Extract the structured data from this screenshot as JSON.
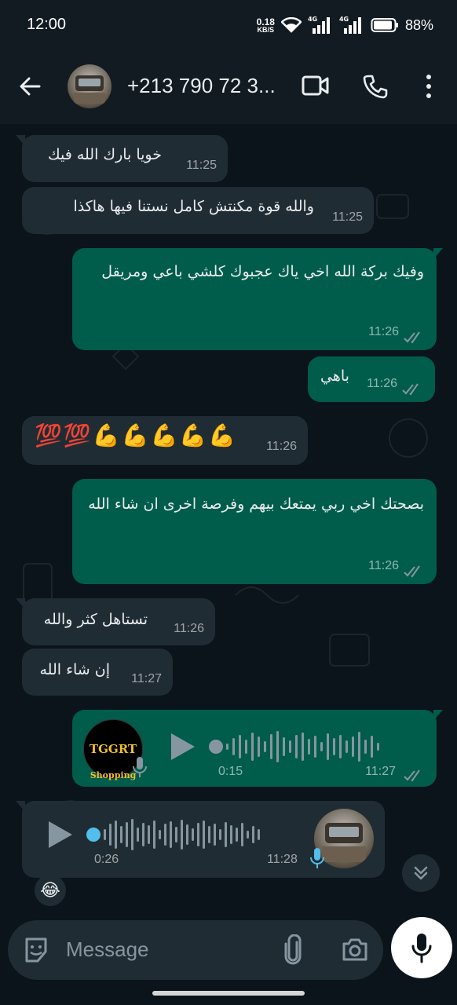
{
  "status_bar": {
    "time": "12:00",
    "net_speed_value": "0.18",
    "net_speed_unit": "KB/S",
    "network_1": "4G",
    "network_2": "4G",
    "battery": "88%"
  },
  "header": {
    "title": "+213 790 72 3...",
    "icons": [
      "back-arrow-icon",
      "video-call-icon",
      "voice-call-icon",
      "more-options-icon"
    ]
  },
  "messages": [
    {
      "direction": "in",
      "text": "خويا بارك الله فيك",
      "time": "11:25"
    },
    {
      "direction": "in",
      "text": "والله قوة مكنتش كامل نستنا فيها هاكذا",
      "time": "11:25"
    },
    {
      "direction": "out",
      "text": "وفيك بركة الله اخي ياك عجبوك كلشي باعي ومريقل",
      "time": "11:26"
    },
    {
      "direction": "out",
      "text": "باهي",
      "time": "11:26"
    },
    {
      "direction": "in",
      "text": "💯💯💪💪💪💪💪",
      "time": "11:26"
    },
    {
      "direction": "out",
      "text": "بصحتك اخي ربي يمتعك بيهم وفرصة اخرى ان شاء الله",
      "time": "11:26"
    },
    {
      "direction": "in",
      "text": "تستاهل كثر والله",
      "time": "11:26"
    },
    {
      "direction": "in",
      "text": "إن شاء الله",
      "time": "11:27"
    }
  ],
  "voice_out": {
    "sender_logo_line1": "TGGRT",
    "sender_logo_line2": "Shopping",
    "duration": "0:15",
    "time": "11:27"
  },
  "voice_in": {
    "duration": "0:26",
    "time": "11:28",
    "reaction": "😂"
  },
  "input": {
    "placeholder": "Message"
  },
  "colors": {
    "incoming": "#202c33",
    "outgoing": "#005c4b",
    "background": "#0b141a",
    "accent_blue": "#53bdeb"
  }
}
